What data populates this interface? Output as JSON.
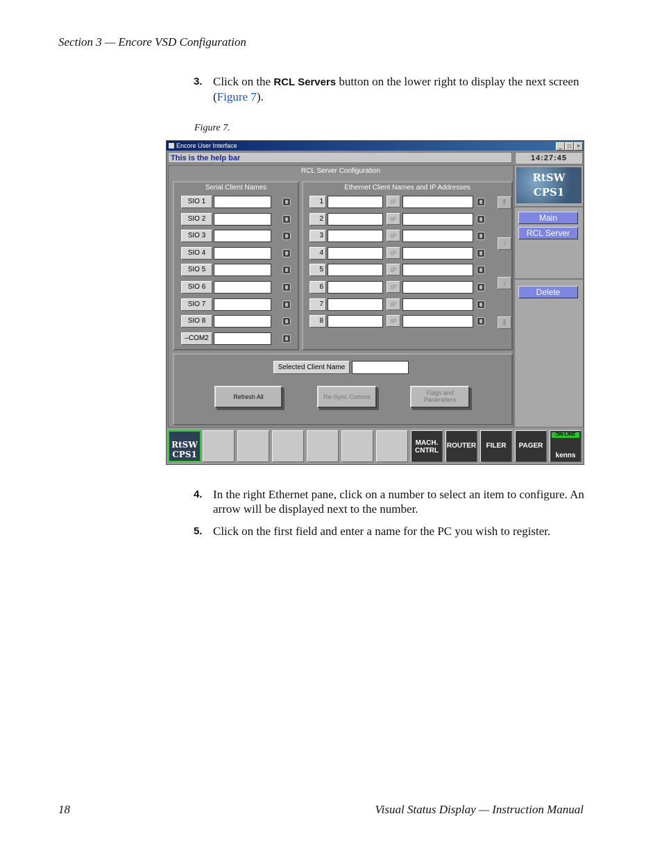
{
  "header": {
    "section": "Section 3 — Encore VSD Configuration"
  },
  "steps": [
    {
      "num": "3.",
      "pre": "Click on the ",
      "keyword": "RCL Servers",
      "post": " button on the lower right to display the next screen (",
      "link": "Figure 7",
      "end": ")."
    },
    {
      "num": "4.",
      "text": "In the right Ethernet pane, click on a number to select an item to configure. An arrow will be displayed next to the number."
    },
    {
      "num": "5.",
      "text": "Click on the first field and enter a name for the PC you wish to register."
    }
  ],
  "figure": {
    "caption": "Figure 7."
  },
  "window": {
    "title": "Encore User Interface",
    "min": "_",
    "max": "□",
    "close": "×",
    "help_bar": "This is the help bar",
    "clock": "14:27:45",
    "main_title": "RCL Server Configuration",
    "serial_title": "Serial Client Names",
    "ethernet_title": "Ethernet Client Names and IP Addresses",
    "serial_buttons": [
      "SIO 1",
      "SIO 2",
      "SIO 3",
      "SIO 4",
      "SIO 5",
      "SIO 6",
      "SIO 7",
      "SIO 8",
      "–COM2"
    ],
    "ethernet_numbers": [
      "1",
      "2",
      "3",
      "4",
      "5",
      "6",
      "7",
      "8"
    ],
    "ip_label": "IP",
    "scroll_icons": {
      "top": "⇑",
      "up": "↑",
      "down": "↓",
      "bottom": "⇓"
    },
    "selected_label": "Selected Client Name",
    "refresh": "Refresh All",
    "resync": "Re-Sync Comms",
    "flags1": "Flags and",
    "flags2": "Parameters",
    "logo1": "RtSW",
    "logo2": "CPS1",
    "nav_main": "Main",
    "nav_rcl": "RCL Server",
    "delete": "Delete",
    "bottom": {
      "rtsw1": "RtSW",
      "rtsw2": "CPS1",
      "mach1": "MACH.",
      "mach2": "CNTRL",
      "router": "ROUTER",
      "filer": "FILER",
      "pager": "PAGER",
      "online": "ON-LINE",
      "user": "kenns"
    }
  },
  "footer": {
    "page": "18",
    "title": "Visual Status Display  —  Instruction Manual"
  }
}
